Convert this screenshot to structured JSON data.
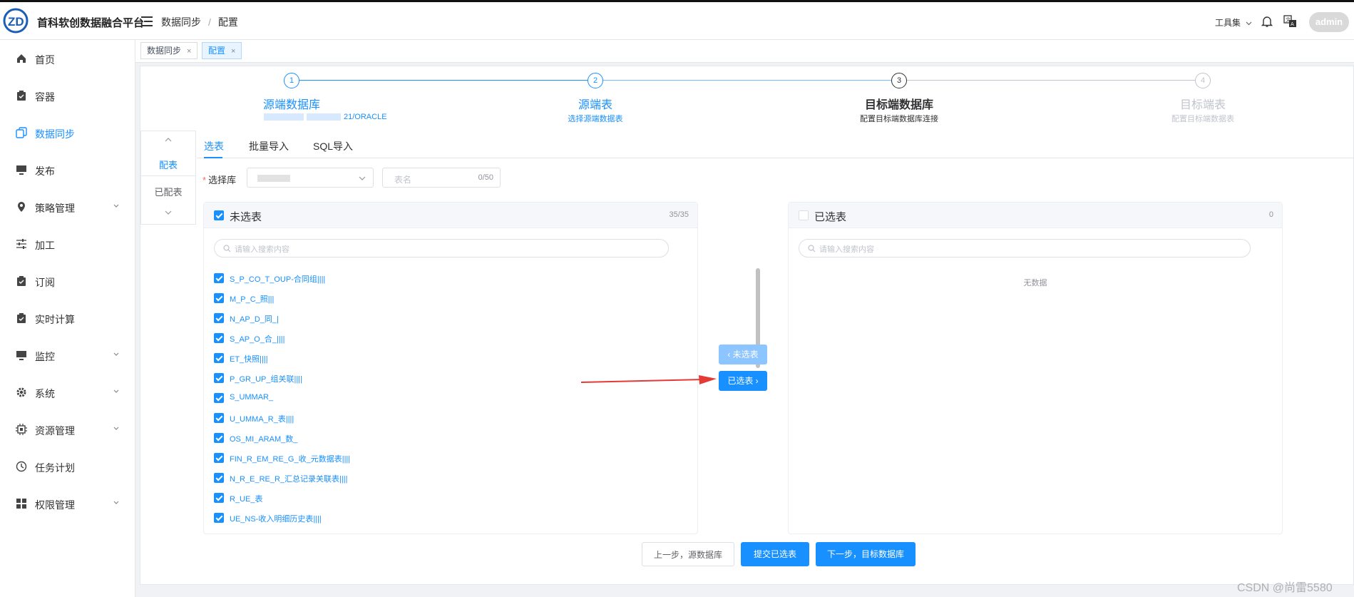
{
  "app": {
    "title": "首科软创数据融合平台"
  },
  "breadcrumb": {
    "first": "数据同步",
    "separator": "/",
    "second": "配置"
  },
  "header": {
    "tools_label": "工具集",
    "user": "admin"
  },
  "sidebar": {
    "items": [
      {
        "label": "首页",
        "icon": "home-icon"
      },
      {
        "label": "容器",
        "icon": "clipboard-icon"
      },
      {
        "label": "数据同步",
        "icon": "copy-icon",
        "active": true
      },
      {
        "label": "发布",
        "icon": "monitor-icon"
      },
      {
        "label": "策略管理",
        "icon": "location-icon",
        "expandable": true
      },
      {
        "label": "加工",
        "icon": "sliders-icon"
      },
      {
        "label": "订阅",
        "icon": "clipboard-check-icon"
      },
      {
        "label": "实时计算",
        "icon": "clipboard-check-icon"
      },
      {
        "label": "监控",
        "icon": "monitor-icon",
        "expandable": true
      },
      {
        "label": "系统",
        "icon": "gear-icon",
        "expandable": true
      },
      {
        "label": "资源管理",
        "icon": "cpu-icon",
        "expandable": true
      },
      {
        "label": "任务计划",
        "icon": "clock-icon"
      },
      {
        "label": "权限管理",
        "icon": "grid-icon",
        "expandable": true
      }
    ]
  },
  "tags": [
    {
      "label": "数据同步",
      "close": "×"
    },
    {
      "label": "配置",
      "close": "×",
      "active": true
    }
  ],
  "steps": [
    {
      "number": "1",
      "title": "源端数据库",
      "desc": "21/ORACLE",
      "state": "done"
    },
    {
      "number": "2",
      "title": "源端表",
      "desc": "选择源端数据表",
      "state": "done"
    },
    {
      "number": "3",
      "title": "目标端数据库",
      "desc": "配置目标端数据库连接",
      "state": "current"
    },
    {
      "number": "4",
      "title": "目标端表",
      "desc": "配置目标端数据表",
      "state": "pending"
    }
  ],
  "vtabs": {
    "first": "配表",
    "second": "已配表"
  },
  "htabs": {
    "tab1": "选表",
    "tab2": "批量导入",
    "tab3": "SQL导入"
  },
  "form": {
    "db_label": "选择库",
    "db_value": "",
    "table_name_placeholder": "表名",
    "table_name_count": "0/50"
  },
  "left_panel": {
    "title": "未选表",
    "count": "35/35",
    "search_placeholder": "请输入搜索内容",
    "rows": [
      "S_P_CO_T_OUP-合同组||||",
      "M_P_C_照|||",
      "N_AP_D_同_|",
      "S_AP_O_合_||||",
      "ET_快照||||",
      "P_GR_UP_组关联||||",
      "S_UMMAR_",
      "U_UMMA_R_表||||",
      "OS_MI_ARAM_数_",
      "FIN_R_EM_RE_G_收_元数据表||||",
      "N_R_E_RE_R_汇总记录关联表||||",
      "R_UE_表",
      "UE_NS-收入明细历史表||||"
    ]
  },
  "right_panel": {
    "title": "已选表",
    "count": "0",
    "search_placeholder": "请输入搜索内容",
    "empty_text": "无数据"
  },
  "transfer": {
    "to_left": "未选表",
    "to_right": "已选表"
  },
  "buttons": {
    "prev": "上一步，源数据库",
    "submit": "提交已选表",
    "next": "下一步，目标数据库"
  },
  "watermark": "CSDN @尚雷5580"
}
